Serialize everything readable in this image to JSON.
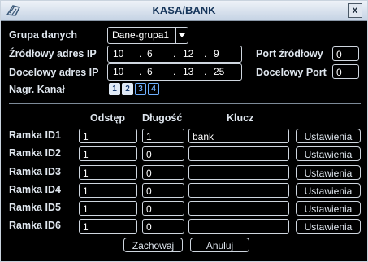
{
  "window": {
    "title": "KASA/BANK",
    "close_label": "x"
  },
  "form": {
    "group_label": "Grupa danych",
    "group_value": "Dane-grupa1",
    "src_ip_label": "Źródłowy adres IP",
    "src_ip": [
      "10",
      "6",
      "12",
      "9"
    ],
    "src_port_label": "Port źródłowy",
    "src_port": "0",
    "dst_ip_label": "Docelowy adres IP",
    "dst_ip": [
      "10",
      "6",
      "13",
      "25"
    ],
    "dst_port_label": "Docelowy Port",
    "dst_port": "0",
    "channel_label": "Nagr. Kanał",
    "channels": [
      "1",
      "2",
      "3",
      "4"
    ]
  },
  "table": {
    "headers": {
      "offset": "Odstęp",
      "length": "Długość",
      "key": "Klucz"
    },
    "rows": [
      {
        "label": "Ramka ID1",
        "offset": "1",
        "length": "1",
        "key": "bank",
        "button": "Ustawienia"
      },
      {
        "label": "Ramka ID2",
        "offset": "1",
        "length": "0",
        "key": "",
        "button": "Ustawienia"
      },
      {
        "label": "Ramka ID3",
        "offset": "1",
        "length": "0",
        "key": "",
        "button": "Ustawienia"
      },
      {
        "label": "Ramka ID4",
        "offset": "1",
        "length": "0",
        "key": "",
        "button": "Ustawienia"
      },
      {
        "label": "Ramka ID5",
        "offset": "1",
        "length": "0",
        "key": "",
        "button": "Ustawienia"
      },
      {
        "label": "Ramka ID6",
        "offset": "1",
        "length": "0",
        "key": "",
        "button": "Ustawienia"
      }
    ]
  },
  "actions": {
    "save": "Zachowaj",
    "cancel": "Anuluj"
  }
}
